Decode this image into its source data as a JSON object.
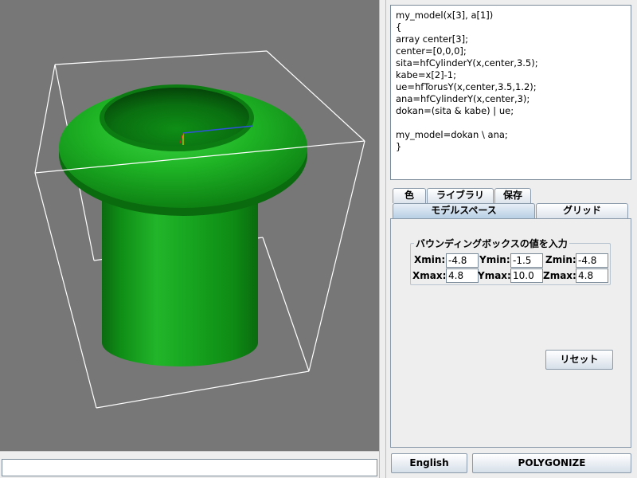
{
  "code_editor": {
    "text": "my_model(x[3], a[1])\n{\narray center[3];\ncenter=[0,0,0];\nsita=hfCylinderY(x,center,3.5);\nkabe=x[2]-1;\nue=hfTorusY(x,center,3.5,1.2);\nana=hfCylinderY(x,center,3);\ndokan=(sita & kabe) | ue;\n\nmy_model=dokan \\ ana;\n}"
  },
  "tabs": {
    "row1": [
      "色",
      "ライブラリ",
      "保存"
    ],
    "row2": [
      "モデルスペース",
      "グリッド"
    ],
    "selected": "モデルスペース"
  },
  "bounding_box": {
    "title": "バウンディングボックスの値を入力",
    "labels": {
      "xmin": "Xmin:",
      "ymin": "Ymin:",
      "zmin": "Zmin:",
      "xmax": "Xmax:",
      "ymax": "Ymax:",
      "zmax": "Zmax:"
    },
    "values": {
      "xmin": "-4.8",
      "ymin": "-1.5",
      "zmin": "-4.8",
      "xmax": "4.8",
      "ymax": "10.0",
      "zmax": "4.8"
    }
  },
  "buttons": {
    "reset": "リセット",
    "language": "English",
    "polygonize": "POLYGONIZE"
  },
  "status": {
    "value": ""
  },
  "colors": {
    "viewport_bg": "#777777",
    "model": "#1aa31a",
    "bounding_box_lines": "#ffffff",
    "selected_tab": "#b8cfe5"
  }
}
